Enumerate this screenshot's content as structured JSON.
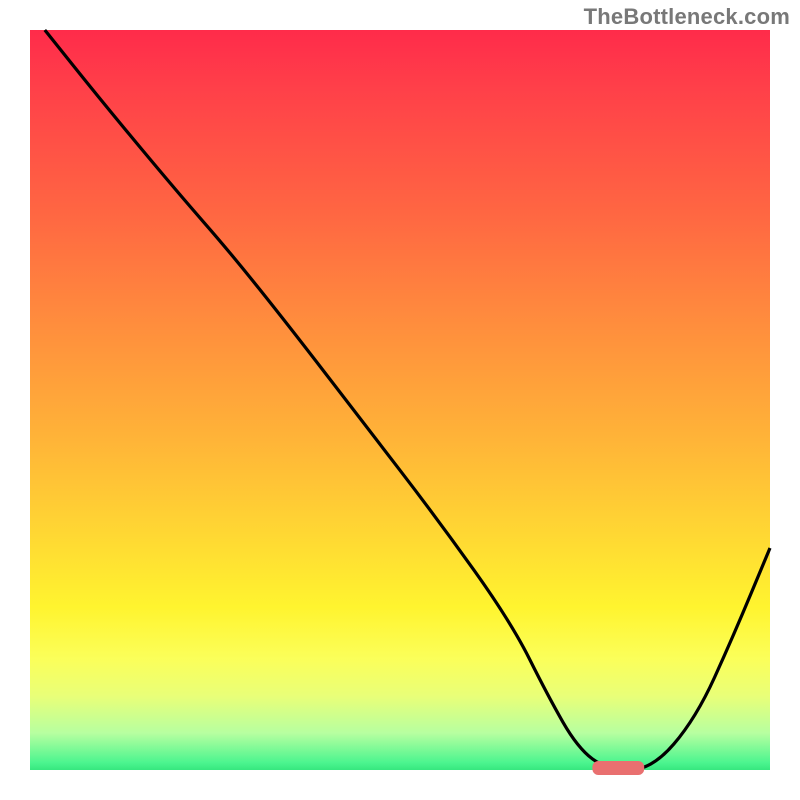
{
  "attribution": "TheBottleneck.com",
  "chart_data": {
    "type": "line",
    "title": "",
    "xlabel": "",
    "ylabel": "",
    "xlim": [
      0,
      100
    ],
    "ylim": [
      0,
      100
    ],
    "series": [
      {
        "name": "bottleneck-curve",
        "x": [
          2,
          10,
          20,
          27,
          35,
          45,
          55,
          65,
          70,
          74,
          78,
          84,
          90,
          95,
          100
        ],
        "y": [
          100,
          90,
          78,
          70,
          60,
          47,
          34,
          20,
          10,
          3,
          0,
          0,
          7,
          18,
          30
        ]
      }
    ],
    "marker": {
      "name": "optimal-region",
      "x_start": 76,
      "x_end": 83,
      "y": 0,
      "color": "#e97070"
    },
    "colors": {
      "curve": "#000000",
      "gradient_top": "#ff2b4a",
      "gradient_mid": "#ffd733",
      "gradient_bottom": "#36e77f",
      "marker": "#e97070"
    }
  }
}
